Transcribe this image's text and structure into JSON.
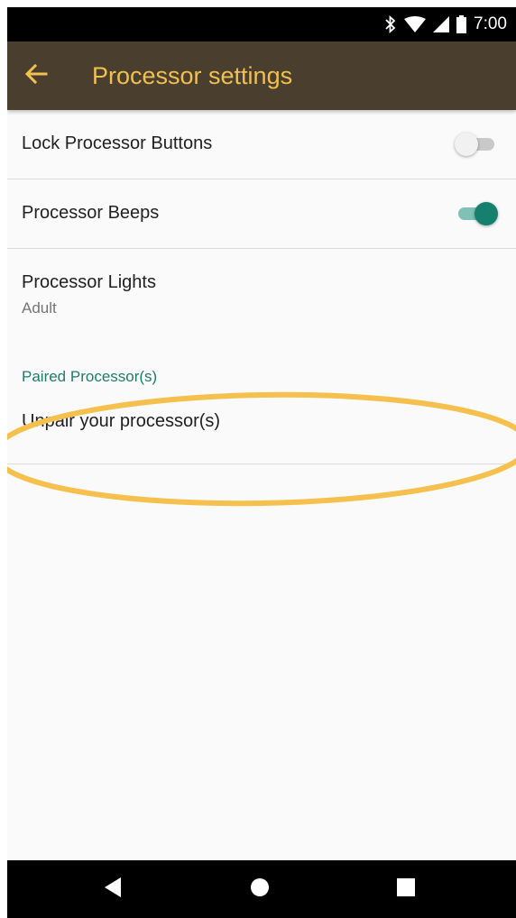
{
  "status_bar": {
    "time": "7:00",
    "icons": [
      "bluetooth-icon",
      "wifi-icon",
      "signal-icon",
      "battery-icon"
    ]
  },
  "app_bar": {
    "title": "Processor settings",
    "back_icon": "arrow-left-icon",
    "background": "#4a3e2f",
    "accent": "#f0c050"
  },
  "settings": {
    "lock_buttons": {
      "label": "Lock Processor Buttons",
      "enabled": false
    },
    "beeps": {
      "label": "Processor Beeps",
      "enabled": true
    },
    "lights": {
      "label": "Processor Lights",
      "value": "Adult"
    },
    "paired_section": {
      "title": "Paired Processor(s)"
    },
    "unpair": {
      "label": "Unpair your processor(s)"
    }
  },
  "colors": {
    "toggle_on": "#15806d",
    "section_header": "#1f7c6a",
    "highlight": "#f5c04e"
  },
  "nav_bar": {
    "buttons": [
      "back-triangle-icon",
      "home-circle-icon",
      "recents-square-icon"
    ]
  }
}
